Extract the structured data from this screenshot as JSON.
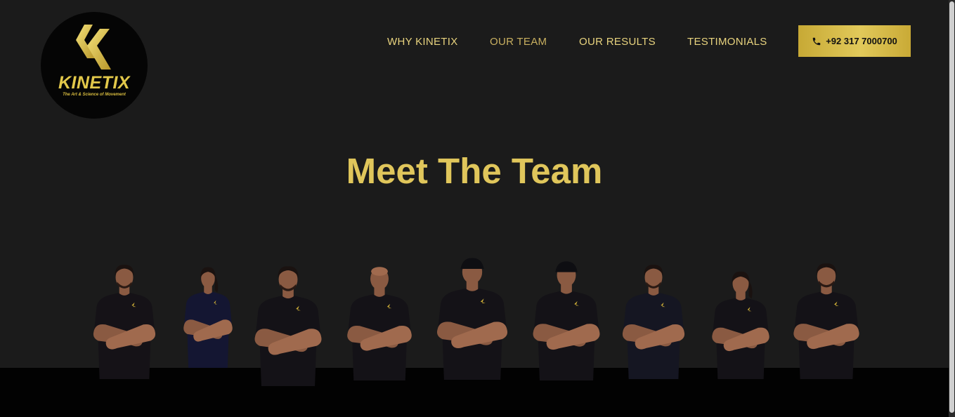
{
  "brand": {
    "name": "KINETIX",
    "tagline": "The Art & Science of Movement",
    "accent": "#e0c65b",
    "background": "#1b1b1b"
  },
  "nav": {
    "items": [
      {
        "label": "WHY KINETIX"
      },
      {
        "label": "OUR TEAM",
        "active": true
      },
      {
        "label": "OUR RESULTS"
      },
      {
        "label": "TESTIMONIALS"
      }
    ]
  },
  "contact": {
    "phone_label": "+92 317 7000700",
    "icon": "phone-icon"
  },
  "section": {
    "title": "Meet The Team"
  },
  "team": {
    "member_count": 9,
    "members": [
      {
        "photo": "team-member-photo",
        "shirt_color": "#151217"
      },
      {
        "photo": "team-member-photo",
        "shirt_color": "#141632"
      },
      {
        "photo": "team-member-photo",
        "shirt_color": "#141217"
      },
      {
        "photo": "team-member-photo",
        "shirt_color": "#141217"
      },
      {
        "photo": "team-member-photo",
        "shirt_color": "#141217"
      },
      {
        "photo": "team-member-photo",
        "shirt_color": "#141217"
      },
      {
        "photo": "team-member-photo",
        "shirt_color": "#151622"
      },
      {
        "photo": "team-member-photo",
        "shirt_color": "#141217"
      },
      {
        "photo": "team-member-photo",
        "shirt_color": "#141217"
      }
    ]
  }
}
